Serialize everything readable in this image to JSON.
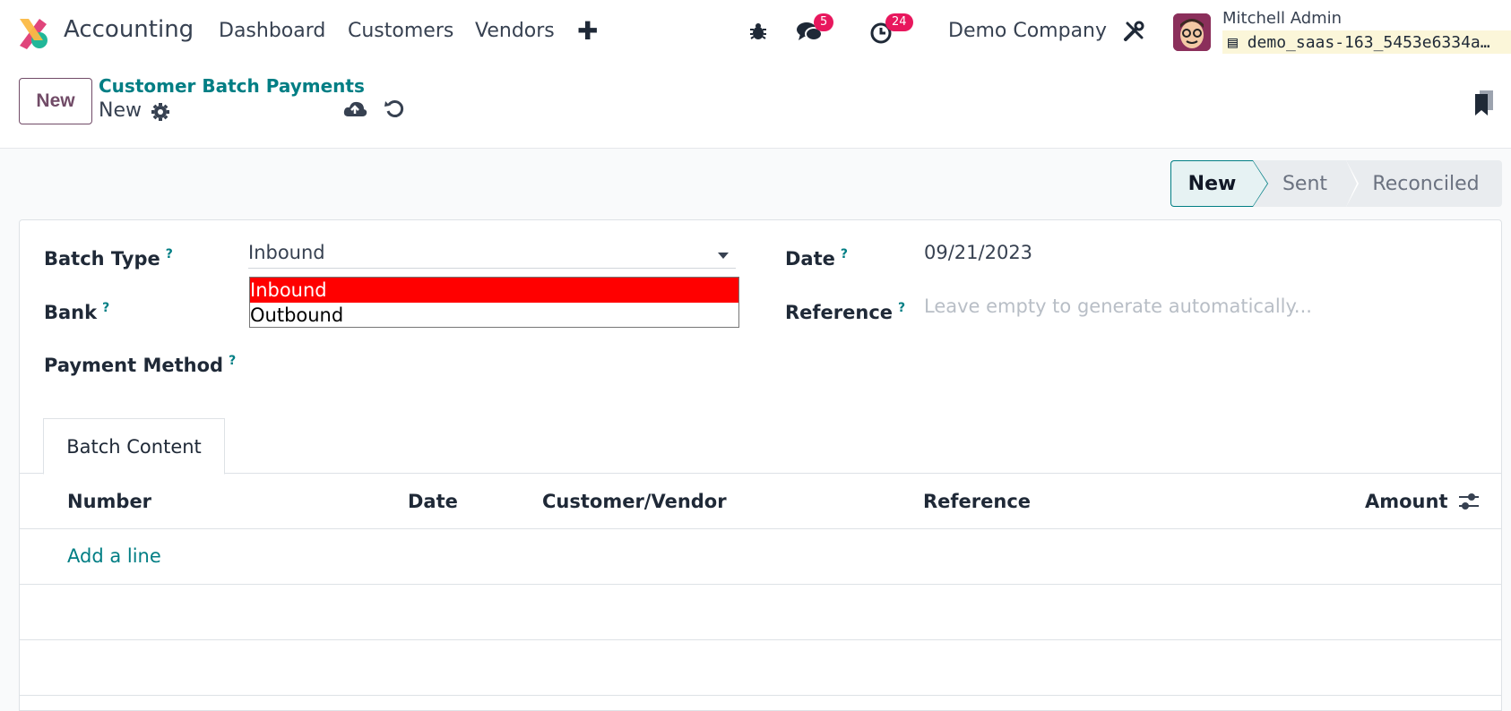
{
  "navbar": {
    "app_name": "Accounting",
    "menu": [
      "Dashboard",
      "Customers",
      "Vendors"
    ],
    "messages_badge": "5",
    "activities_badge": "24",
    "company": "Demo Company",
    "user_name": "Mitchell Admin",
    "database": "demo_saas-163_5453e6334a…"
  },
  "control_panel": {
    "new_label": "New",
    "breadcrumb_parent": "Customer Batch Payments",
    "breadcrumb_current": "New"
  },
  "statusbar": {
    "stages": [
      "New",
      "Sent",
      "Reconciled"
    ],
    "active": "New"
  },
  "form": {
    "batch_type_label": "Batch Type",
    "batch_type_value": "Inbound",
    "batch_type_options": [
      "Inbound",
      "Outbound"
    ],
    "bank_label": "Bank",
    "payment_method_label": "Payment Method",
    "date_label": "Date",
    "date_value": "09/21/2023",
    "reference_label": "Reference",
    "reference_placeholder": "Leave empty to generate automatically...",
    "help_marker": "?"
  },
  "tabs": {
    "batch_content": "Batch Content"
  },
  "table": {
    "columns": [
      "Number",
      "Date",
      "Customer/Vendor",
      "Reference",
      "Amount"
    ],
    "add_line": "Add a line"
  },
  "colors": {
    "brand": "#714b67",
    "accent": "#017e84",
    "badge": "#e8175d"
  }
}
